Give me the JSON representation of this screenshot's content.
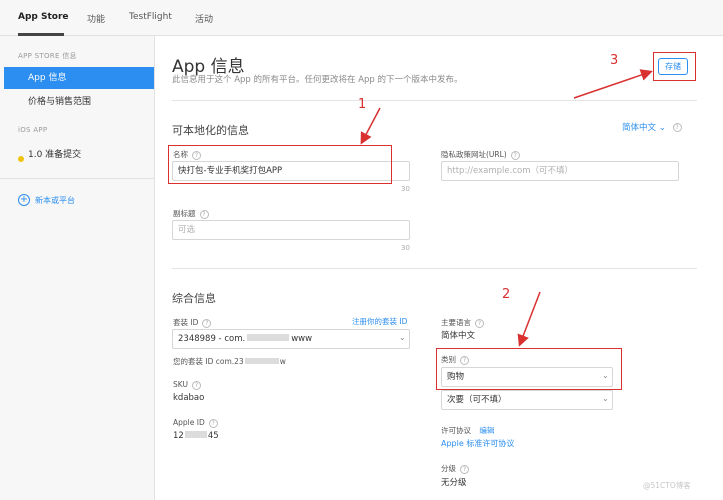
{
  "topbar": {
    "tabs": [
      "App Store",
      "功能",
      "TestFlight",
      "活动"
    ]
  },
  "sidebar": {
    "section_store": "APP STORE 信息",
    "item_app_info": "App 信息",
    "item_pricing": "价格与销售范围",
    "section_ios": "iOS APP",
    "item_version": "1.0 准备提交",
    "new_platform": "新本或平台"
  },
  "header": {
    "title": "App 信息",
    "description": "此信息用于这个 App 的所有平台。任何更改将在 App 的下一个版本中发布。",
    "save_label": "存储"
  },
  "localizable": {
    "title": "可本地化的信息",
    "language": "简体中文",
    "name_label": "名称",
    "name_value": "快打包-专业手机奖打包APP",
    "name_count": "30",
    "privacy_label": "隐私政策网址(URL)",
    "privacy_placeholder": "http://example.com（可不填）",
    "subtitle_label": "副标题",
    "subtitle_placeholder": "可选",
    "subtitle_count": "30"
  },
  "general": {
    "title": "综合信息",
    "bundle_id_label": "套装 ID",
    "bundle_register_link": "注册你的套装 ID",
    "bundle_id_value": "2348989 - com.",
    "bundle_id_suffix": "www",
    "bundle_prefix_label": "您的套装 ID com.23",
    "bundle_prefix_suffix": "w",
    "sku_label": "SKU",
    "sku_value": "kdabao",
    "apple_id_label": "Apple ID",
    "apple_id_value_start": "12",
    "apple_id_value_end": "45",
    "primary_lang_label": "主要语言",
    "primary_lang_value": "简体中文",
    "category_label": "类别",
    "category_primary": "购物",
    "category_secondary": "次要（可不填）",
    "license_label": "许可协议",
    "license_edit": "编辑",
    "license_value": "Apple 标准许可协议",
    "rating_label": "分级",
    "rating_value": "无分级"
  },
  "annotations": {
    "one": "1",
    "two": "2",
    "three": "3"
  },
  "watermark": "@51CTO博客",
  "icons": {
    "help": "?",
    "chevron": "⌄",
    "plus": "+"
  },
  "colors": {
    "accent": "#2b8ef0",
    "annotation": "#d93030",
    "status_dot": "#f0c20c"
  }
}
